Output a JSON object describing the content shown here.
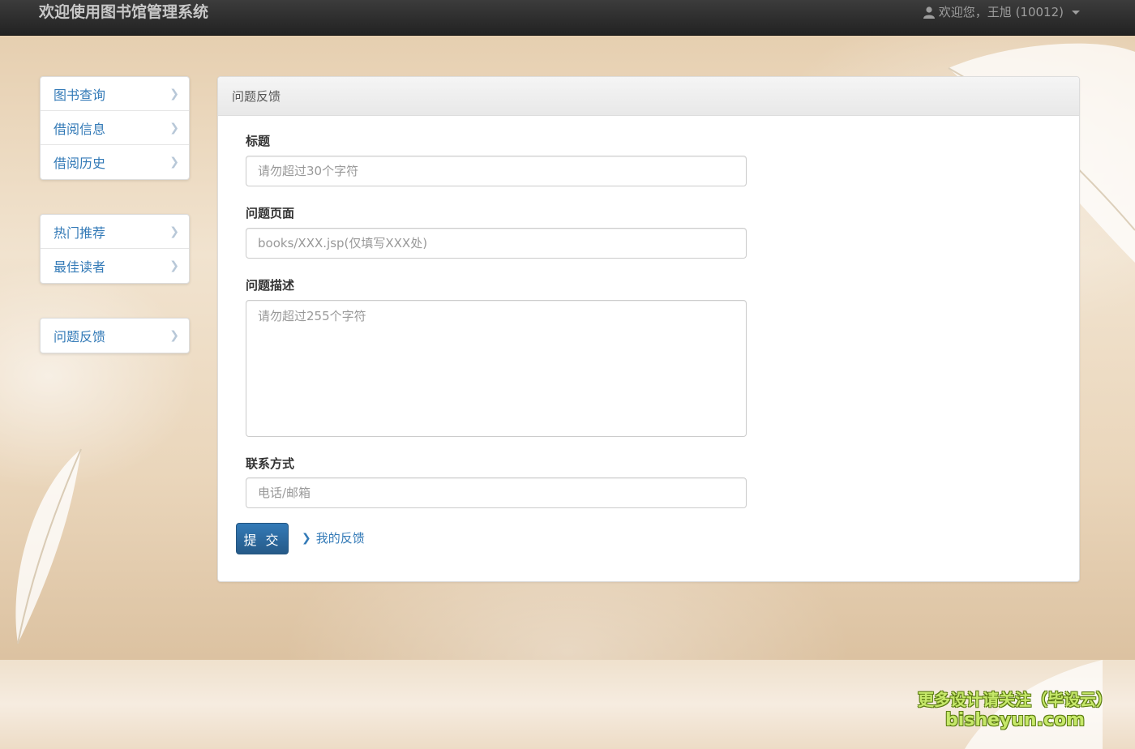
{
  "navbar": {
    "brand": "欢迎使用图书馆管理系统",
    "user_label": "欢迎您，王旭 (10012)"
  },
  "sidebar": {
    "group1": [
      {
        "label": "图书查询"
      },
      {
        "label": "借阅信息"
      },
      {
        "label": "借阅历史"
      }
    ],
    "group2": [
      {
        "label": "热门推荐"
      },
      {
        "label": "最佳读者"
      }
    ],
    "group3": [
      {
        "label": "问题反馈"
      }
    ]
  },
  "panel": {
    "title": "问题反馈",
    "fields": {
      "title_label": "标题",
      "title_placeholder": "请勿超过30个字符",
      "page_label": "问题页面",
      "page_placeholder": "books/XXX.jsp(仅填写XXX处)",
      "desc_label": "问题描述",
      "desc_placeholder": "请勿超过255个字符",
      "contact_label": "联系方式",
      "contact_placeholder": "电话/邮箱"
    },
    "submit_label": "提 交",
    "my_feedback_label": "我的反馈"
  },
  "watermark": {
    "line1": "更多设计请关注（毕设云）",
    "line2": "bisheyun.com"
  },
  "colors": {
    "link": "#337ab7",
    "navbar": "#222222",
    "watermark": "#c6e86a"
  }
}
